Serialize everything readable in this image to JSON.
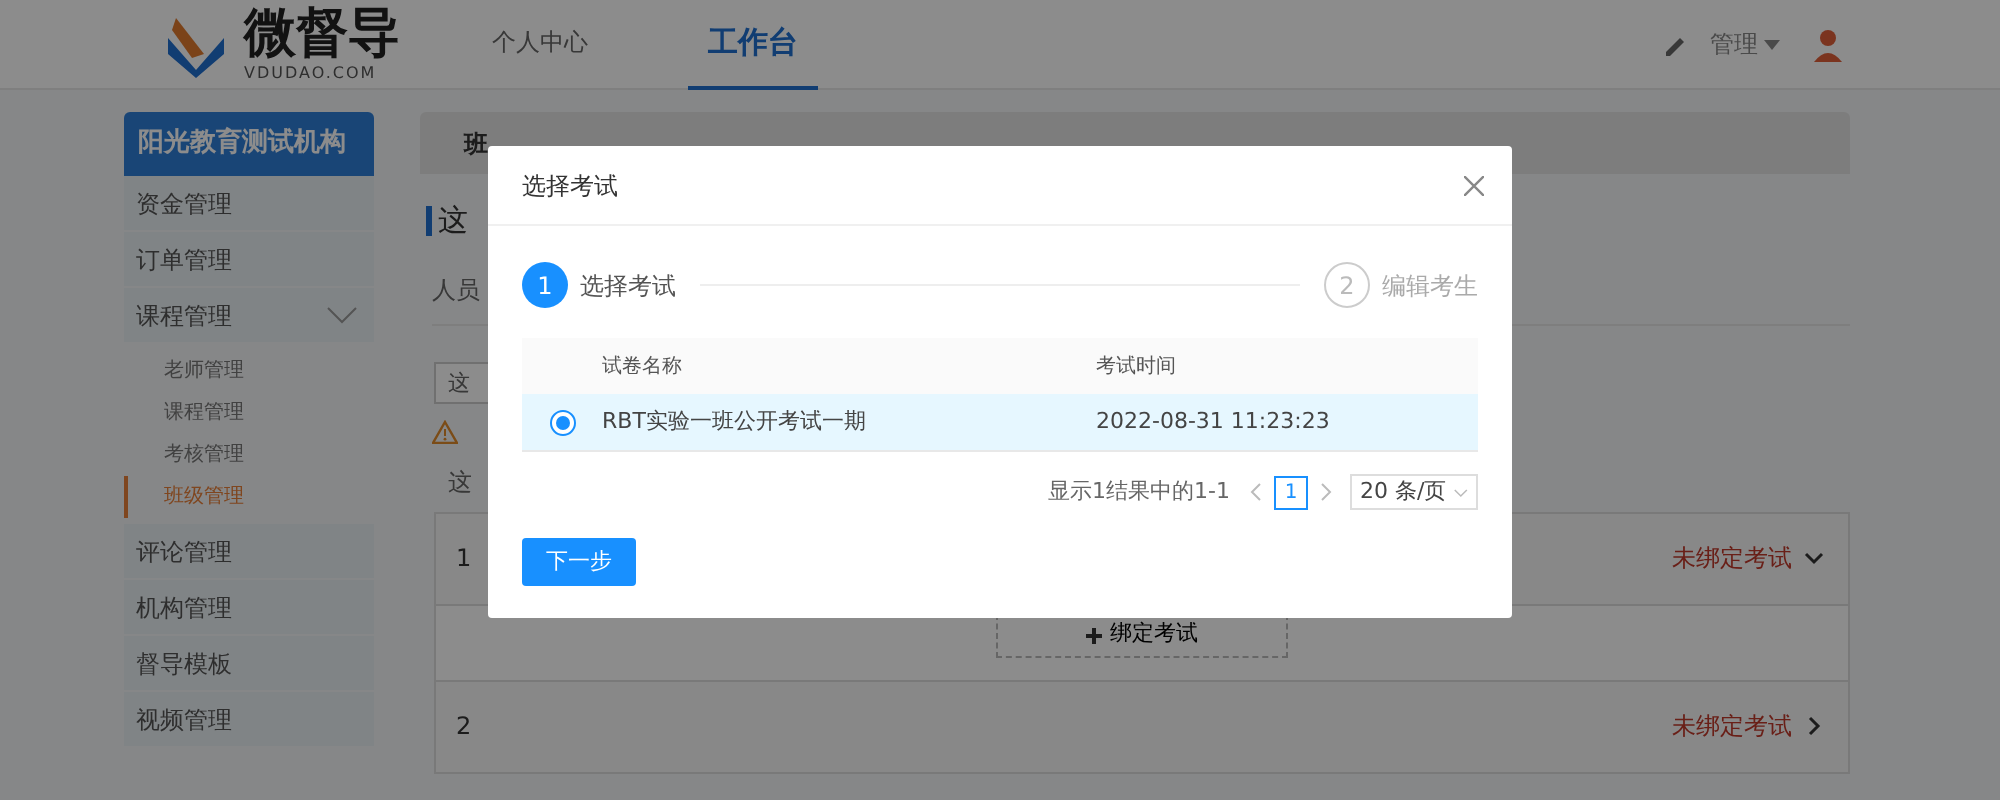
{
  "header": {
    "logo": {
      "name": "微督导",
      "sub": "VDUDAO.COM"
    },
    "nav": [
      {
        "label": "个人中心",
        "selected": false
      },
      {
        "label": "工作台",
        "selected": true
      }
    ],
    "user": {
      "name": "管理"
    }
  },
  "sidebar": {
    "title": "阳光教育测试机构",
    "items": [
      {
        "label": "资金管理"
      },
      {
        "label": "订单管理"
      },
      {
        "label": "课程管理",
        "expanded": true,
        "children": [
          {
            "label": "老师管理",
            "selected": false
          },
          {
            "label": "课程管理",
            "selected": false
          },
          {
            "label": "考核管理",
            "selected": false
          },
          {
            "label": "班级管理",
            "selected": true
          }
        ]
      },
      {
        "label": "评论管理"
      },
      {
        "label": "机构管理"
      },
      {
        "label": "督导模板"
      },
      {
        "label": "视频管理"
      }
    ]
  },
  "main": {
    "breadcrumb": "班",
    "heading": "这",
    "tab_label": "人员",
    "input_value": "这",
    "note": "这",
    "groups": [
      {
        "index": "1",
        "status": "未绑定考试",
        "expanded": true,
        "action": "绑定考试"
      },
      {
        "index": "2",
        "status": "未绑定考试",
        "expanded": false
      }
    ]
  },
  "modal": {
    "title": "选择考试",
    "steps": [
      {
        "number": "1",
        "label": "选择考试",
        "selected": true
      },
      {
        "number": "2",
        "label": "编辑考生",
        "selected": false
      }
    ],
    "table": {
      "columns": [
        "试卷名称",
        "考试时间"
      ],
      "rows": [
        {
          "selected": true,
          "cells": [
            "RBT实验一班公开考试一期",
            "2022-08-31 11:23:23"
          ]
        }
      ]
    },
    "pagination": {
      "summary": "显示1结果中的1-1",
      "pages": [
        {
          "label": "1",
          "selected": true
        }
      ],
      "page_size": "20 条/页"
    },
    "next_button": "下一步"
  }
}
